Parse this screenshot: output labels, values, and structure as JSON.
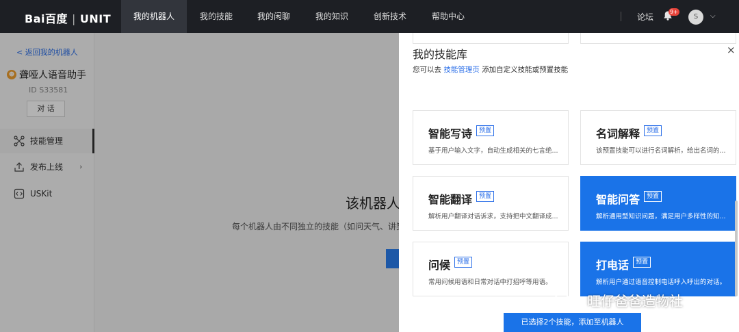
{
  "logo": {
    "brand": "Bai百度",
    "divider": "|",
    "product": "UNIT"
  },
  "nav": {
    "items": [
      {
        "label": "我的机器人"
      },
      {
        "label": "我的技能"
      },
      {
        "label": "我的闲聊"
      },
      {
        "label": "我的知识"
      },
      {
        "label": "创新技术"
      },
      {
        "label": "帮助中心"
      }
    ],
    "active_index": 0,
    "forum": "论坛",
    "badge": "9+",
    "avatar_initial": "S"
  },
  "sidebar": {
    "back": "< 返回我的机器人",
    "bot_name": "聋哑人语音助手",
    "bot_id": "ID S33581",
    "chat_button": "对 话",
    "items": [
      {
        "label": "技能管理",
        "icon": "skill-network-icon"
      },
      {
        "label": "发布上线",
        "icon": "upload-icon"
      },
      {
        "label": "USKit",
        "icon": "code-icon"
      }
    ]
  },
  "main": {
    "title": "该机器人",
    "desc": "每个机器人由不同独立的技能（如问天气、讲笑"
  },
  "drawer": {
    "title": "我的技能库",
    "subtitle_pre": "您可以去",
    "subtitle_link": "技能管理页",
    "subtitle_post": "添加自定义技能或预置技能",
    "close": "×",
    "cards": [
      {
        "name": "智能写诗",
        "tag": "预置",
        "desc": "基于用户输入文字，自动生成相关的七言绝...",
        "selected": false
      },
      {
        "name": "名词解释",
        "tag": "预置",
        "desc": "该预置技能可以进行名词解析，给出名词的...",
        "selected": false
      },
      {
        "name": "智能翻译",
        "tag": "预置",
        "desc": "解析用户翻译对话诉求，支持把中文翻译成...",
        "selected": false
      },
      {
        "name": "智能问答",
        "tag": "预置",
        "desc": "解析通用型知识问题，满足用户多样性的知...",
        "selected": true
      },
      {
        "name": "问候",
        "tag": "预置",
        "desc": "常用问候用语和日常对话中打招呼等用语。",
        "selected": false
      },
      {
        "name": "打电话",
        "tag": "预置",
        "desc": "解析用户通过语音控制电话呼入呼出的对话。",
        "selected": true
      }
    ],
    "add_button": "已选择2个技能，添加至机器人"
  },
  "watermark": "旺仔爸爸造物社",
  "colors": {
    "topbar": "#1d1f24",
    "accent": "#1a73e8",
    "badge": "#e8453c",
    "bot_icon": "#f0a030"
  }
}
